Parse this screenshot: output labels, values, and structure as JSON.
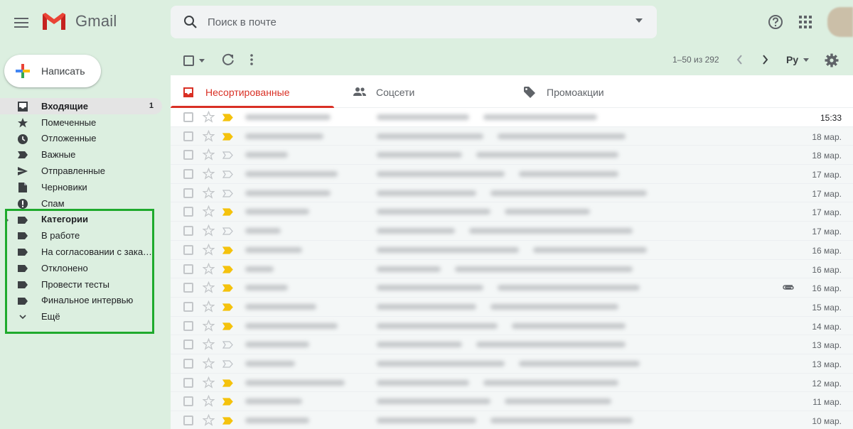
{
  "app": {
    "name": "Gmail"
  },
  "search": {
    "placeholder": "Поиск в почте"
  },
  "compose": {
    "label": "Написать"
  },
  "nav": [
    {
      "label": "Входящие",
      "icon": "inbox-icon",
      "count": "1",
      "active": true
    },
    {
      "label": "Помеченные",
      "icon": "star-icon"
    },
    {
      "label": "Отложенные",
      "icon": "clock-icon"
    },
    {
      "label": "Важные",
      "icon": "important-icon"
    },
    {
      "label": "Отправленные",
      "icon": "send-icon"
    },
    {
      "label": "Черновики",
      "icon": "draft-icon"
    },
    {
      "label": "Спам",
      "icon": "spam-icon"
    },
    {
      "label": "Категории",
      "icon": "label-icon",
      "bold": true
    },
    {
      "label": "В работе",
      "icon": "label-icon"
    },
    {
      "label": "На согласовании с заказчиком",
      "icon": "label-icon"
    },
    {
      "label": "Отклонено",
      "icon": "label-icon"
    },
    {
      "label": "Провести тесты",
      "icon": "label-icon"
    },
    {
      "label": "Финальное интервью",
      "icon": "label-icon"
    },
    {
      "label": "Ещё",
      "icon": "chevron-down-icon"
    }
  ],
  "toolbar": {
    "pager": "1–50 из 292",
    "lang": "Ру"
  },
  "tabs": [
    {
      "label": "Несортированные",
      "icon": "inbox-icon",
      "active": true
    },
    {
      "label": "Соцсети",
      "icon": "people-icon"
    },
    {
      "label": "Промоакции",
      "icon": "tag-icon"
    }
  ],
  "emails": [
    {
      "date": "15:33",
      "important": true,
      "unread": true
    },
    {
      "date": "18 мар.",
      "important": true
    },
    {
      "date": "18 мар.",
      "important": false
    },
    {
      "date": "17 мар.",
      "important": false
    },
    {
      "date": "17 мар.",
      "important": false
    },
    {
      "date": "17 мар.",
      "important": true
    },
    {
      "date": "17 мар.",
      "important": false
    },
    {
      "date": "16 мар.",
      "important": true
    },
    {
      "date": "16 мар.",
      "important": true
    },
    {
      "date": "16 мар.",
      "important": true,
      "attachment": true
    },
    {
      "date": "15 мар.",
      "important": true
    },
    {
      "date": "14 мар.",
      "important": true
    },
    {
      "date": "13 мар.",
      "important": false
    },
    {
      "date": "13 мар.",
      "important": false
    },
    {
      "date": "12 мар.",
      "important": true
    },
    {
      "date": "11 мар.",
      "important": true
    },
    {
      "date": "10 мар.",
      "important": true
    }
  ],
  "colors": {
    "accent_red": "#d93025",
    "highlight_green": "#1faa2d",
    "important_yellow": "#f4c20d",
    "background": "#dcefe0"
  }
}
